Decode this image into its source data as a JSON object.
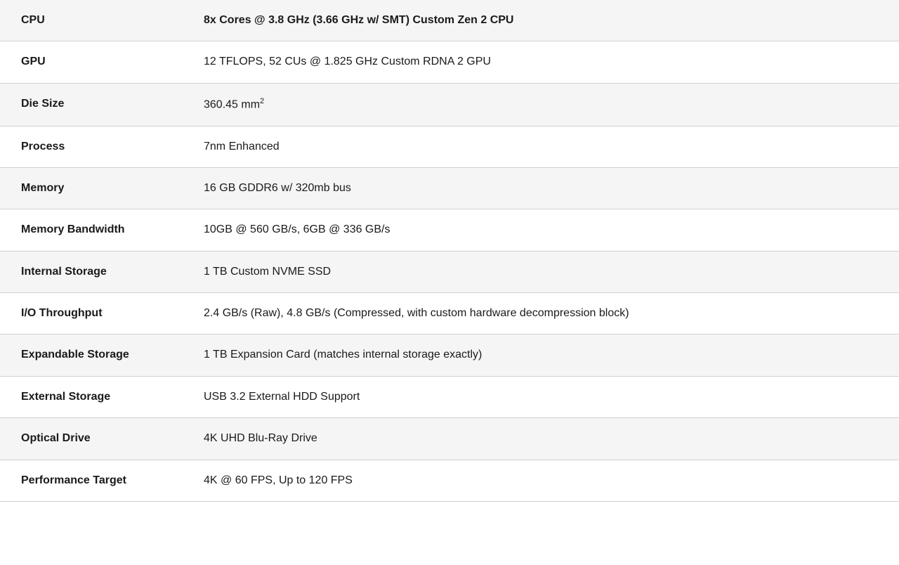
{
  "specs": [
    {
      "label": "CPU",
      "value": "8x Cores @ 3.8 GHz (3.66 GHz w/ SMT) Custom Zen 2 CPU",
      "bold_value": true,
      "has_superscript": false
    },
    {
      "label": "GPU",
      "value": "12 TFLOPS, 52 CUs @ 1.825 GHz Custom RDNA 2 GPU",
      "bold_value": false,
      "has_superscript": false
    },
    {
      "label": "Die Size",
      "value": "360.45 mm",
      "superscript": "2",
      "bold_value": false,
      "has_superscript": true
    },
    {
      "label": "Process",
      "value": "7nm Enhanced",
      "bold_value": false,
      "has_superscript": false
    },
    {
      "label": "Memory",
      "value": "16 GB GDDR6 w/ 320mb bus",
      "bold_value": false,
      "has_superscript": false
    },
    {
      "label": "Memory Bandwidth",
      "value": "10GB @ 560 GB/s, 6GB @ 336 GB/s",
      "bold_value": false,
      "has_superscript": false
    },
    {
      "label": "Internal Storage",
      "value": "1 TB Custom NVME SSD",
      "bold_value": false,
      "has_superscript": false
    },
    {
      "label": "I/O Throughput",
      "value": "2.4 GB/s (Raw), 4.8 GB/s (Compressed, with custom hardware decompression block)",
      "bold_value": false,
      "has_superscript": false
    },
    {
      "label": "Expandable Storage",
      "value": "1 TB Expansion Card (matches internal storage exactly)",
      "bold_value": false,
      "has_superscript": false
    },
    {
      "label": "External Storage",
      "value": "USB 3.2 External HDD Support",
      "bold_value": false,
      "has_superscript": false
    },
    {
      "label": "Optical Drive",
      "value": "4K UHD Blu-Ray Drive",
      "bold_value": false,
      "has_superscript": false
    },
    {
      "label": "Performance Target",
      "value": "4K @ 60 FPS, Up to 120 FPS",
      "bold_value": false,
      "has_superscript": false
    }
  ]
}
